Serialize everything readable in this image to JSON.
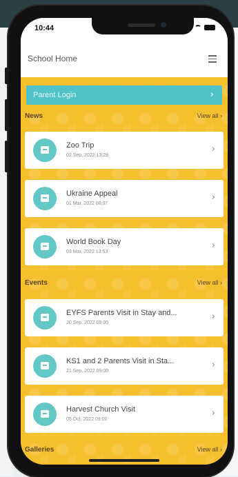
{
  "status_bar": {
    "time": "10:44"
  },
  "header": {
    "title": "School Home",
    "menu_icon": "hamburger-menu-icon"
  },
  "parent_login": {
    "label": "Parent Login"
  },
  "sections": {
    "news": {
      "title": "News",
      "view_all": "View all",
      "items": [
        {
          "title": "Zoo Trip",
          "date": "02 Sep, 2022 13:29",
          "icon": "news-icon"
        },
        {
          "title": "Ukraine Appeal",
          "date": "01 Mar, 2022 08:37",
          "icon": "news-icon"
        },
        {
          "title": "World Book Day",
          "date": "03 Mar, 2022 13:53",
          "icon": "news-icon"
        }
      ]
    },
    "events": {
      "title": "Events",
      "view_all": "View all",
      "items": [
        {
          "title": "EYFS Parents Visit in Stay and...",
          "date": "20 Sep, 2022 09:00",
          "icon": "event-icon"
        },
        {
          "title": "KS1 and 2 Parents Visit in Sta...",
          "date": "21 Sep, 2022 09:00",
          "icon": "event-icon"
        },
        {
          "title": "Harvest Church Visit",
          "date": "05 Oct, 2022 09:00",
          "icon": "event-icon"
        }
      ]
    },
    "galleries": {
      "title": "Galleries",
      "view_all": "View all"
    }
  },
  "colors": {
    "accent": "#62c7c5",
    "background": "#f6bf2d",
    "login_bar": "#4fc3c8"
  }
}
